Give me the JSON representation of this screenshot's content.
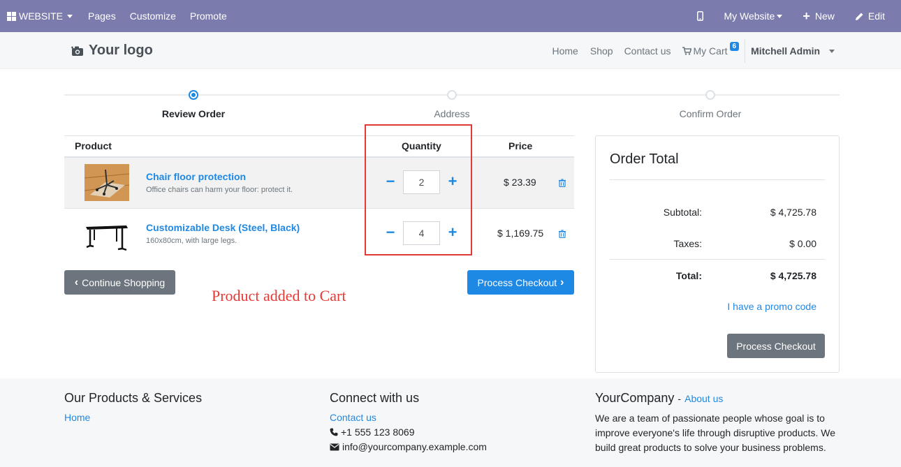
{
  "adminbar": {
    "website_label": "WEBSITE",
    "pages": "Pages",
    "customize": "Customize",
    "promote": "Promote",
    "my_website": "My Website",
    "new": "New",
    "edit": "Edit",
    "bg_color": "#7c7bad"
  },
  "header": {
    "logo_text": "Your logo",
    "nav": {
      "home": "Home",
      "shop": "Shop",
      "contact": "Contact us",
      "cart": "My Cart",
      "cart_count": "6",
      "user": "Mitchell Admin"
    }
  },
  "wizard": {
    "steps": [
      "Review Order",
      "Address",
      "Confirm Order"
    ],
    "active": 0
  },
  "cart": {
    "headers": {
      "product": "Product",
      "quantity": "Quantity",
      "price": "Price"
    },
    "rows": [
      {
        "name": "Chair floor protection",
        "desc": "Office chairs can harm your floor: protect it.",
        "qty": "2",
        "price": "$ 23.39",
        "thumb_icon": "chair-mat-image"
      },
      {
        "name": "Customizable Desk (Steel, Black)",
        "desc": "160x80cm, with large legs.",
        "qty": "4",
        "price": "$ 1,169.75",
        "thumb_icon": "desk-image"
      }
    ],
    "continue_label": "Continue Shopping",
    "checkout_label": "Process Checkout",
    "annotation": "Product added to Cart"
  },
  "order_total": {
    "title": "Order Total",
    "subtotal_label": "Subtotal:",
    "subtotal": "$ 4,725.78",
    "taxes_label": "Taxes:",
    "taxes": "$ 0.00",
    "total_label": "Total:",
    "total": "$ 4,725.78",
    "promo": "I have a promo code",
    "checkout_label": "Process Checkout"
  },
  "footer": {
    "col1_title": "Our Products & Services",
    "col1_link": "Home",
    "col2_title": "Connect with us",
    "col2_link": "Contact us",
    "phone": "+1 555 123 8069",
    "email": "info@yourcompany.example.com",
    "col3_title": "YourCompany",
    "col3_sep": "-",
    "col3_link": "About us",
    "col3_text": "We are a team of passionate people whose goal is to improve everyone's life through disruptive products. We build great products to solve your business problems."
  },
  "colors": {
    "accent": "#1e88e5",
    "annotation": "#e53935",
    "grey_button": "#6c757d"
  }
}
